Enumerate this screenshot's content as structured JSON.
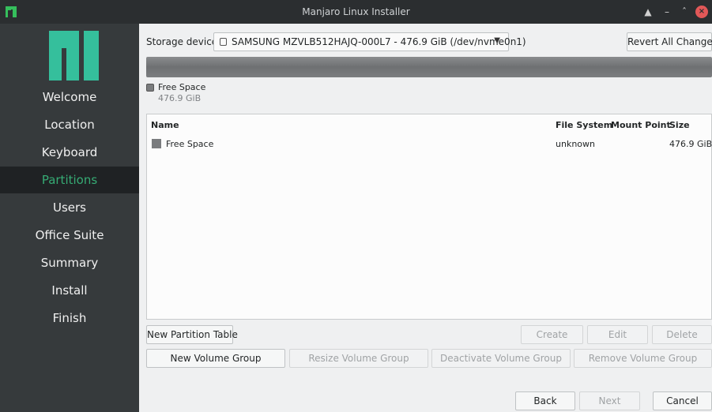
{
  "window": {
    "title": "Manjaro Linux Installer"
  },
  "sidebar": {
    "items": [
      {
        "label": "Welcome",
        "active": false
      },
      {
        "label": "Location",
        "active": false
      },
      {
        "label": "Keyboard",
        "active": false
      },
      {
        "label": "Partitions",
        "active": true
      },
      {
        "label": "Users",
        "active": false
      },
      {
        "label": "Office Suite",
        "active": false
      },
      {
        "label": "Summary",
        "active": false
      },
      {
        "label": "Install",
        "active": false
      },
      {
        "label": "Finish",
        "active": false
      }
    ]
  },
  "storage": {
    "label": "Storage device:",
    "device": "SAMSUNG MZVLB512HAJQ-000L7 - 476.9 GiB (/dev/nvme0n1)",
    "revert_label": "Revert All Changes"
  },
  "legend": {
    "name": "Free Space",
    "size": "476.9 GiB"
  },
  "table": {
    "headers": {
      "name": "Name",
      "fs": "File System",
      "mount": "Mount Point",
      "size": "Size"
    },
    "rows": [
      {
        "name": "Free Space",
        "fs": "unknown",
        "mount": "",
        "size": "476.9 GiB"
      }
    ]
  },
  "buttons": {
    "new_partition_table": "New Partition Table",
    "create": "Create",
    "edit": "Edit",
    "delete": "Delete",
    "new_volume_group": "New Volume Group",
    "resize_volume_group": "Resize Volume Group",
    "deactivate_volume_group": "Deactivate Volume Group",
    "remove_volume_group": "Remove Volume Group",
    "back": "Back",
    "next": "Next",
    "cancel": "Cancel"
  },
  "colors": {
    "accent": "#36ab74",
    "sidebar_bg": "#363a3c",
    "titlebar_bg": "#2b2e30"
  }
}
